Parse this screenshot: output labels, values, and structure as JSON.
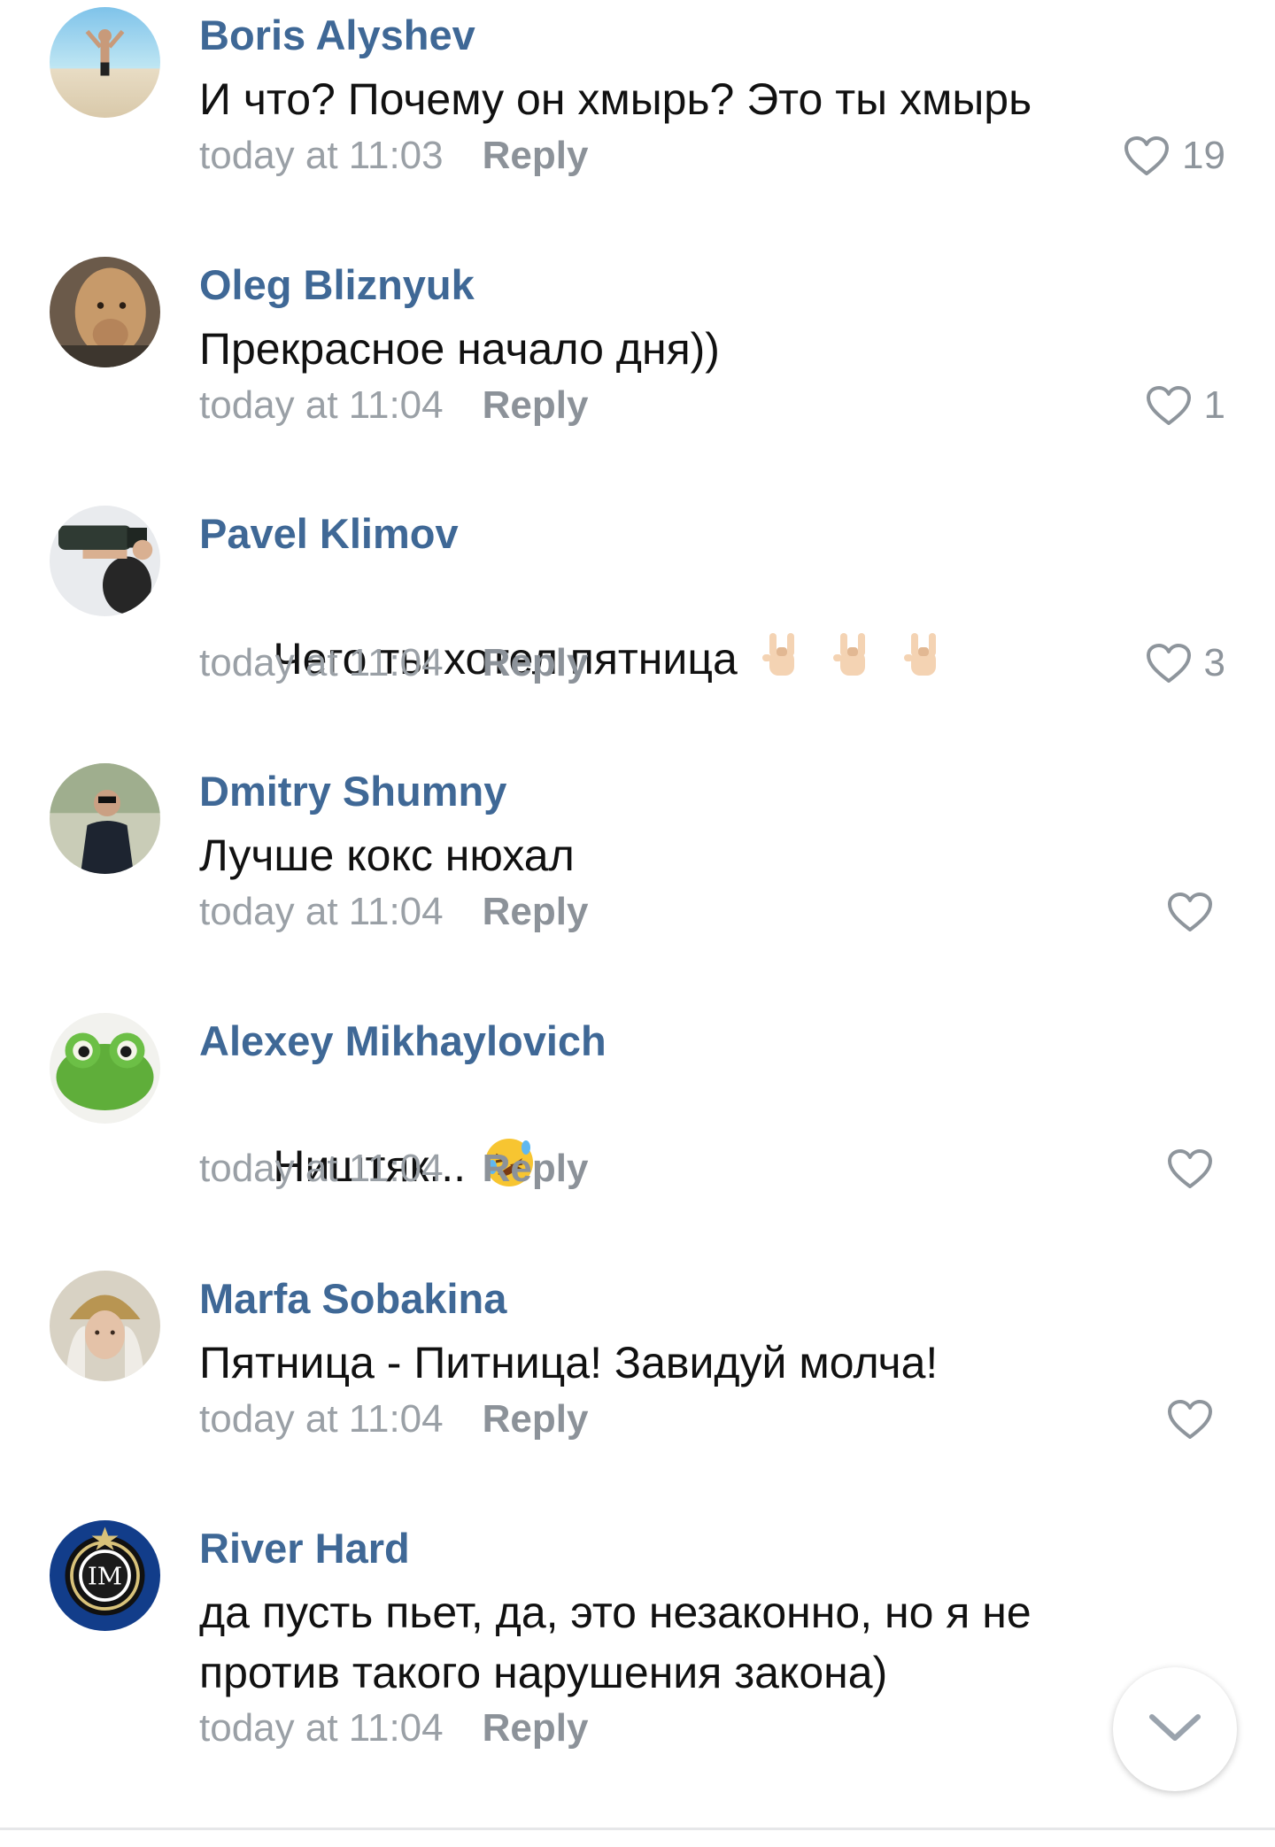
{
  "comments": [
    {
      "author": "Boris Alyshev",
      "text": "И что? Почему он хмырь? Это ты хмырь",
      "time": "today at 11:03",
      "reply": "Reply",
      "likes": "19"
    },
    {
      "author": "Oleg Bliznyuk",
      "text": "Прекрасное начало дня))",
      "time": "today at 11:04",
      "reply": "Reply",
      "likes": "1"
    },
    {
      "author": "Pavel Klimov",
      "text": "Чего ты хотел пятница",
      "time": "today at 11:04",
      "reply": "Reply",
      "likes": "3"
    },
    {
      "author": "Dmitry Shumny",
      "text": "Лучше кокс нюхал",
      "time": "today at 11:04",
      "reply": "Reply",
      "likes": ""
    },
    {
      "author": "Alexey Mikhaylovich",
      "text": "Ништяк...",
      "time": "today at 11:04",
      "reply": "Reply",
      "likes": ""
    },
    {
      "author": "Marfa Sobakina",
      "text": "Пятница - Питница! Завидуй молча!",
      "time": "today at 11:04",
      "reply": "Reply",
      "likes": ""
    },
    {
      "author": "River Hard",
      "text": "да пусть пьет, да, это незаконно, но я не\nпротив такого нарушения закона)",
      "time": "today at 11:04",
      "reply": "Reply",
      "likes": ""
    }
  ],
  "colors": {
    "author": "#3f6896",
    "text": "#111111",
    "meta": "#9aa0a6",
    "like_icon": "#8e959c"
  },
  "icons": {
    "like": "heart-outline-icon",
    "scroll": "chevron-down-icon"
  }
}
